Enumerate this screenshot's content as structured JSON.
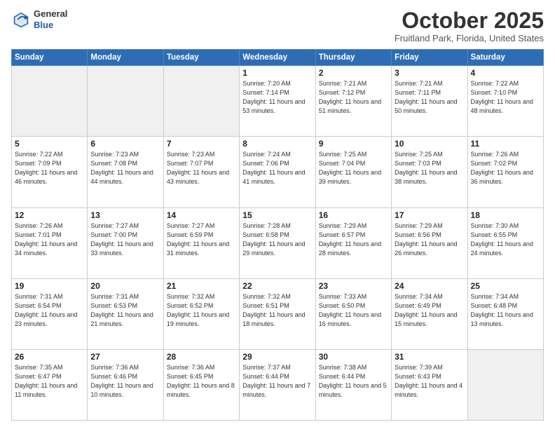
{
  "header": {
    "logo_general": "General",
    "logo_blue": "Blue",
    "month_title": "October 2025",
    "location": "Fruitland Park, Florida, United States"
  },
  "weekdays": [
    "Sunday",
    "Monday",
    "Tuesday",
    "Wednesday",
    "Thursday",
    "Friday",
    "Saturday"
  ],
  "weeks": [
    [
      {
        "day": "",
        "empty": true
      },
      {
        "day": "",
        "empty": true
      },
      {
        "day": "",
        "empty": true
      },
      {
        "day": "1",
        "sunrise": "7:20 AM",
        "sunset": "7:14 PM",
        "daylight": "11 hours and 53 minutes."
      },
      {
        "day": "2",
        "sunrise": "7:21 AM",
        "sunset": "7:12 PM",
        "daylight": "11 hours and 51 minutes."
      },
      {
        "day": "3",
        "sunrise": "7:21 AM",
        "sunset": "7:11 PM",
        "daylight": "11 hours and 50 minutes."
      },
      {
        "day": "4",
        "sunrise": "7:22 AM",
        "sunset": "7:10 PM",
        "daylight": "11 hours and 48 minutes."
      }
    ],
    [
      {
        "day": "5",
        "sunrise": "7:22 AM",
        "sunset": "7:09 PM",
        "daylight": "11 hours and 46 minutes."
      },
      {
        "day": "6",
        "sunrise": "7:23 AM",
        "sunset": "7:08 PM",
        "daylight": "11 hours and 44 minutes."
      },
      {
        "day": "7",
        "sunrise": "7:23 AM",
        "sunset": "7:07 PM",
        "daylight": "11 hours and 43 minutes."
      },
      {
        "day": "8",
        "sunrise": "7:24 AM",
        "sunset": "7:06 PM",
        "daylight": "11 hours and 41 minutes."
      },
      {
        "day": "9",
        "sunrise": "7:25 AM",
        "sunset": "7:04 PM",
        "daylight": "11 hours and 39 minutes."
      },
      {
        "day": "10",
        "sunrise": "7:25 AM",
        "sunset": "7:03 PM",
        "daylight": "11 hours and 38 minutes."
      },
      {
        "day": "11",
        "sunrise": "7:26 AM",
        "sunset": "7:02 PM",
        "daylight": "11 hours and 36 minutes."
      }
    ],
    [
      {
        "day": "12",
        "sunrise": "7:26 AM",
        "sunset": "7:01 PM",
        "daylight": "11 hours and 34 minutes."
      },
      {
        "day": "13",
        "sunrise": "7:27 AM",
        "sunset": "7:00 PM",
        "daylight": "11 hours and 33 minutes."
      },
      {
        "day": "14",
        "sunrise": "7:27 AM",
        "sunset": "6:59 PM",
        "daylight": "11 hours and 31 minutes."
      },
      {
        "day": "15",
        "sunrise": "7:28 AM",
        "sunset": "6:58 PM",
        "daylight": "11 hours and 29 minutes."
      },
      {
        "day": "16",
        "sunrise": "7:29 AM",
        "sunset": "6:57 PM",
        "daylight": "11 hours and 28 minutes."
      },
      {
        "day": "17",
        "sunrise": "7:29 AM",
        "sunset": "6:56 PM",
        "daylight": "11 hours and 26 minutes."
      },
      {
        "day": "18",
        "sunrise": "7:30 AM",
        "sunset": "6:55 PM",
        "daylight": "11 hours and 24 minutes."
      }
    ],
    [
      {
        "day": "19",
        "sunrise": "7:31 AM",
        "sunset": "6:54 PM",
        "daylight": "11 hours and 23 minutes."
      },
      {
        "day": "20",
        "sunrise": "7:31 AM",
        "sunset": "6:53 PM",
        "daylight": "11 hours and 21 minutes."
      },
      {
        "day": "21",
        "sunrise": "7:32 AM",
        "sunset": "6:52 PM",
        "daylight": "11 hours and 19 minutes."
      },
      {
        "day": "22",
        "sunrise": "7:32 AM",
        "sunset": "6:51 PM",
        "daylight": "11 hours and 18 minutes."
      },
      {
        "day": "23",
        "sunrise": "7:33 AM",
        "sunset": "6:50 PM",
        "daylight": "11 hours and 16 minutes."
      },
      {
        "day": "24",
        "sunrise": "7:34 AM",
        "sunset": "6:49 PM",
        "daylight": "11 hours and 15 minutes."
      },
      {
        "day": "25",
        "sunrise": "7:34 AM",
        "sunset": "6:48 PM",
        "daylight": "11 hours and 13 minutes."
      }
    ],
    [
      {
        "day": "26",
        "sunrise": "7:35 AM",
        "sunset": "6:47 PM",
        "daylight": "11 hours and 11 minutes."
      },
      {
        "day": "27",
        "sunrise": "7:36 AM",
        "sunset": "6:46 PM",
        "daylight": "11 hours and 10 minutes."
      },
      {
        "day": "28",
        "sunrise": "7:36 AM",
        "sunset": "6:45 PM",
        "daylight": "11 hours and 8 minutes."
      },
      {
        "day": "29",
        "sunrise": "7:37 AM",
        "sunset": "6:44 PM",
        "daylight": "11 hours and 7 minutes."
      },
      {
        "day": "30",
        "sunrise": "7:38 AM",
        "sunset": "6:44 PM",
        "daylight": "11 hours and 5 minutes."
      },
      {
        "day": "31",
        "sunrise": "7:39 AM",
        "sunset": "6:43 PM",
        "daylight": "11 hours and 4 minutes."
      },
      {
        "day": "",
        "empty": true
      }
    ]
  ]
}
